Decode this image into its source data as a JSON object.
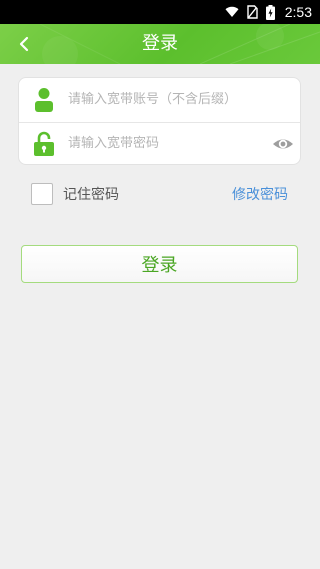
{
  "status_bar": {
    "time": "2:53"
  },
  "header": {
    "title": "登录"
  },
  "form": {
    "account_placeholder": "请输入宽带账号（不含后缀）",
    "password_placeholder": "请输入宽带密码"
  },
  "options": {
    "remember_label": "记住密码",
    "change_password_label": "修改密码"
  },
  "actions": {
    "login_label": "登录"
  },
  "colors": {
    "brand_green": "#5cbf2d",
    "link_blue": "#4a90d9",
    "button_text_green": "#4aa623"
  }
}
